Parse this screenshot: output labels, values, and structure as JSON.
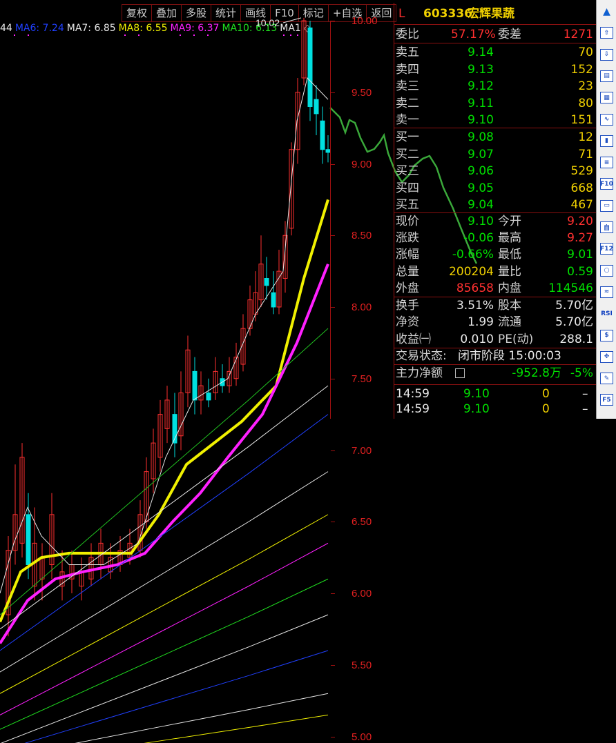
{
  "toolbar": [
    "复权",
    "叠加",
    "多股",
    "统计",
    "画线",
    "F10",
    "标记",
    "+自选",
    "返回"
  ],
  "ma_legend": [
    {
      "label": "44",
      "color": "#e8e8e8"
    },
    {
      "label": "MA6: 7.24",
      "color": "#2040ff"
    },
    {
      "label": "MA7: 6.85",
      "color": "#e8e8e8"
    },
    {
      "label": "MA8: 6.55",
      "color": "#f0f000"
    },
    {
      "label": "MA9: 6.37",
      "color": "#ff20ff"
    },
    {
      "label": "MA10: 6.13",
      "color": "#20e020"
    },
    {
      "label": "MA1",
      "color": "#e8e8e8"
    }
  ],
  "price_axis": [
    "10.00",
    "9.50",
    "9.00",
    "8.50",
    "8.00",
    "7.50",
    "7.00",
    "6.50",
    "6.00",
    "5.50",
    "5.00"
  ],
  "high_marker": "10.02",
  "stock": {
    "flag": "L",
    "code": "603336",
    "name": "宏辉果蔬"
  },
  "weibi": {
    "label1": "委比",
    "value1": "57.17%",
    "label2": "委差",
    "value2": "1271"
  },
  "asks": [
    {
      "label": "卖五",
      "price": "9.14",
      "vol": "70"
    },
    {
      "label": "卖四",
      "price": "9.13",
      "vol": "152"
    },
    {
      "label": "卖三",
      "price": "9.12",
      "vol": "23"
    },
    {
      "label": "卖二",
      "price": "9.11",
      "vol": "80"
    },
    {
      "label": "卖一",
      "price": "9.10",
      "vol": "151"
    }
  ],
  "bids": [
    {
      "label": "买一",
      "price": "9.08",
      "vol": "12"
    },
    {
      "label": "买二",
      "price": "9.07",
      "vol": "71"
    },
    {
      "label": "买三",
      "price": "9.06",
      "vol": "529"
    },
    {
      "label": "买四",
      "price": "9.05",
      "vol": "668"
    },
    {
      "label": "买五",
      "price": "9.04",
      "vol": "467"
    }
  ],
  "quote": [
    {
      "l1": "现价",
      "v1": "9.10",
      "c1": "green",
      "l2": "今开",
      "v2": "9.20",
      "c2": "red"
    },
    {
      "l1": "涨跌",
      "v1": "-0.06",
      "c1": "green",
      "l2": "最高",
      "v2": "9.27",
      "c2": "red"
    },
    {
      "l1": "涨幅",
      "v1": "-0.66%",
      "c1": "green",
      "l2": "最低",
      "v2": "9.01",
      "c2": "green"
    },
    {
      "l1": "总量",
      "v1": "200204",
      "c1": "yellow",
      "l2": "量比",
      "v2": "0.59",
      "c2": "green"
    },
    {
      "l1": "外盘",
      "v1": "85658",
      "c1": "red",
      "l2": "内盘",
      "v2": "114546",
      "c2": "green"
    }
  ],
  "fundamentals": [
    {
      "l1": "换手",
      "v1": "3.51%",
      "l2": "股本",
      "v2": "5.70亿"
    },
    {
      "l1": "净资",
      "v1": "1.99",
      "l2": "流通",
      "v2": "5.70亿"
    },
    {
      "l1": "收益㈠",
      "v1": "0.010",
      "l2": "PE(动)",
      "v2": "288.1"
    }
  ],
  "status": {
    "label": "交易状态:",
    "value": "闭市阶段 15:00:03"
  },
  "mainflow": {
    "label": "主力净额",
    "value": "-952.8万",
    "pct": "-5%"
  },
  "ticks": [
    {
      "time": "14:59",
      "price": "9.10",
      "vol": "0",
      "dir": "–"
    },
    {
      "time": "14:59",
      "price": "9.10",
      "vol": "0",
      "dir": "–"
    }
  ],
  "sidebar_icons": [
    "arrow-up-icon",
    "arrow-up-outline-icon",
    "arrow-down-outline-icon",
    "report-icon",
    "table-icon",
    "line-chart-icon",
    "candle-chart-icon",
    "list-icon",
    "f10-icon",
    "news-icon",
    "self-icon",
    "f12-icon",
    "circle-icon",
    "wave-icon",
    "rsi-icon",
    "dollar-icon",
    "move-icon",
    "pen-icon",
    "f5-icon"
  ],
  "colors": {
    "up": "#ff3030",
    "down": "#00e0e0",
    "grid": "#a01010"
  }
}
